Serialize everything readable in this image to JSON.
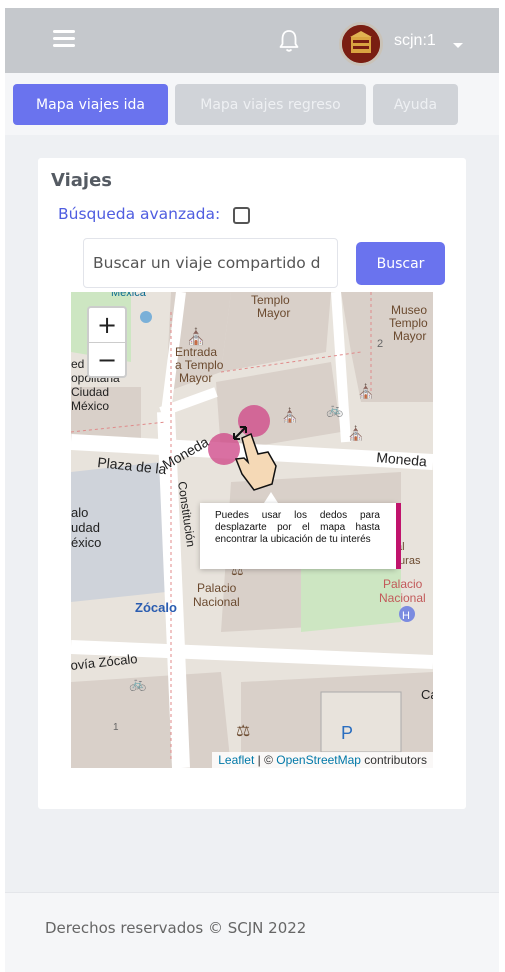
{
  "navbar": {
    "username": "scjn:1"
  },
  "tabs": [
    {
      "label": "Mapa viajes ida",
      "active": true
    },
    {
      "label": "Mapa viajes regreso",
      "active": false
    },
    {
      "label": "Ayuda",
      "active": false
    }
  ],
  "card": {
    "title": "Viajes",
    "advanced_search_label": "Búsqueda avanzada:",
    "search_value": "Buscar un viaje compartido d",
    "search_button": "Buscar"
  },
  "map": {
    "zoom_in": "+",
    "zoom_out": "−",
    "labels": {
      "templo_mayor": "Templo Mayor",
      "museo_templo_mayor": "Museo Templo Mayor",
      "entrada_templo_mayor": "Entrada a Templo Mayor",
      "moneda_1": "Moneda",
      "moneda_2": "Moneda",
      "plaza_constitucion": "Plaza de la Constitución",
      "palacio_nacional": "Palacio Nacional",
      "palacio_nacional_2": "Palacio Nacional",
      "zocalo": "Zócalo",
      "zocalo_via": "ovía Zócalo",
      "mexico_frag": "México",
      "ciudad_frag": "Ciudad",
      "metropolitana_frag": "opolitana",
      "lo_frag": "alo",
      "udad_frag": "udad",
      "exico_frag": "éxico",
      "turas_frag": "turas",
      "al_frag": "al",
      "ca_frag": "Ca",
      "mexicq_frag": "Mexica",
      "num_2": "2",
      "num_1": "1"
    },
    "attribution_leaflet": "Leaflet",
    "attribution_sep": " | © ",
    "attribution_osm": "OpenStreetMap",
    "attribution_tail": " contributors",
    "tooltip": "Puedes usar los dedos para desplazarte por el mapa hasta encontrar la ubicación de tu interés",
    "accent_color": "#c0136c"
  },
  "footer": {
    "text": "Derechos reservados © SCJN 2022"
  },
  "colors": {
    "primary": "#6a73ee",
    "navbar": "#c5c8cc"
  }
}
